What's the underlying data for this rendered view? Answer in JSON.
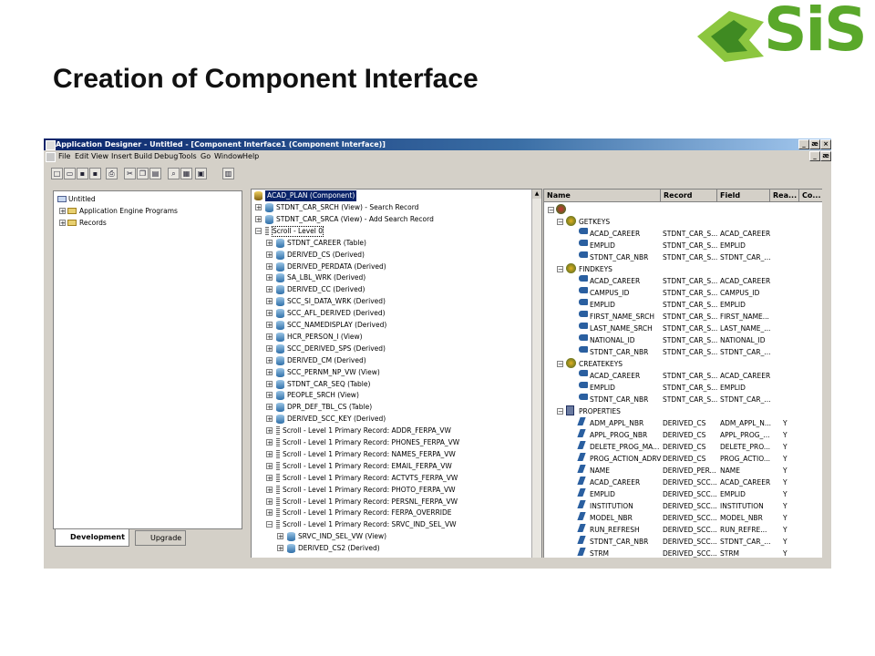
{
  "slide": {
    "title": "Creation of Component Interface",
    "logo_text": "SiS",
    "logo_color": "#5aa82a"
  },
  "window": {
    "title": "Application Designer - Untitled - [Component Interface1 (Component Interface)]",
    "menu": [
      "File",
      "Edit",
      "View",
      "Insert",
      "Build",
      "Debug",
      "Tools",
      "Go",
      "Window",
      "Help"
    ],
    "controls": [
      "_",
      "æ",
      "×"
    ]
  },
  "project": {
    "items": [
      {
        "label": "Untitled",
        "level": 0
      },
      {
        "label": "Application Engine Programs",
        "level": 1
      },
      {
        "label": "Records",
        "level": 1
      }
    ],
    "tabs": [
      "Development",
      "Upgrade"
    ]
  },
  "component_tree": {
    "root": "ACAD_PLAN (Component)",
    "rows": [
      {
        "label": "STDNT_CAR_SRCH (View) - Search Record",
        "indent": 0,
        "icon": "record"
      },
      {
        "label": "STDNT_CAR_SRCA (View) - Add Search Record",
        "indent": 0,
        "icon": "record"
      },
      {
        "label": "Scroll - Level 0",
        "indent": 0,
        "icon": "scroll"
      },
      {
        "label": "STDNT_CAREER (Table)",
        "indent": 1,
        "icon": "record"
      },
      {
        "label": "DERIVED_CS (Derived)",
        "indent": 1,
        "icon": "record"
      },
      {
        "label": "DERIVED_PERDATA (Derived)",
        "indent": 1,
        "icon": "record"
      },
      {
        "label": "SA_LBL_WRK (Derived)",
        "indent": 1,
        "icon": "record"
      },
      {
        "label": "DERIVED_CC (Derived)",
        "indent": 1,
        "icon": "record"
      },
      {
        "label": "SCC_SI_DATA_WRK (Derived)",
        "indent": 1,
        "icon": "record"
      },
      {
        "label": "SCC_AFL_DERIVED (Derived)",
        "indent": 1,
        "icon": "record"
      },
      {
        "label": "SCC_NAMEDISPLAY (Derived)",
        "indent": 1,
        "icon": "record"
      },
      {
        "label": "HCR_PERSON_I (View)",
        "indent": 1,
        "icon": "record"
      },
      {
        "label": "SCC_DERIVED_SPS (Derived)",
        "indent": 1,
        "icon": "record"
      },
      {
        "label": "DERIVED_CM (Derived)",
        "indent": 1,
        "icon": "record"
      },
      {
        "label": "SCC_PERNM_NP_VW (View)",
        "indent": 1,
        "icon": "record"
      },
      {
        "label": "STDNT_CAR_SEQ (Table)",
        "indent": 1,
        "icon": "record"
      },
      {
        "label": "PEOPLE_SRCH (View)",
        "indent": 1,
        "icon": "record"
      },
      {
        "label": "DPR_DEF_TBL_CS (Table)",
        "indent": 1,
        "icon": "record"
      },
      {
        "label": "DERIVED_SCC_KEY (Derived)",
        "indent": 1,
        "icon": "record"
      },
      {
        "label": "Scroll - Level 1  Primary Record: ADDR_FERPA_VW",
        "indent": 1,
        "icon": "scroll"
      },
      {
        "label": "Scroll - Level 1  Primary Record: PHONES_FERPA_VW",
        "indent": 1,
        "icon": "scroll"
      },
      {
        "label": "Scroll - Level 1  Primary Record: NAMES_FERPA_VW",
        "indent": 1,
        "icon": "scroll"
      },
      {
        "label": "Scroll - Level 1  Primary Record: EMAIL_FERPA_VW",
        "indent": 1,
        "icon": "scroll"
      },
      {
        "label": "Scroll - Level 1  Primary Record: ACTVTS_FERPA_VW",
        "indent": 1,
        "icon": "scroll"
      },
      {
        "label": "Scroll - Level 1  Primary Record: PHOTO_FERPA_VW",
        "indent": 1,
        "icon": "scroll"
      },
      {
        "label": "Scroll - Level 1  Primary Record: PERSNL_FERPA_VW",
        "indent": 1,
        "icon": "scroll"
      },
      {
        "label": "Scroll - Level 1  Primary Record: FERPA_OVERRIDE",
        "indent": 1,
        "icon": "scroll"
      },
      {
        "label": "Scroll - Level 1  Primary Record: SRVC_IND_SEL_VW",
        "indent": 1,
        "icon": "scroll"
      },
      {
        "label": "SRVC_IND_SEL_VW (View)",
        "indent": 2,
        "icon": "record"
      },
      {
        "label": "DERIVED_CS2 (Derived)",
        "indent": 2,
        "icon": "record"
      }
    ]
  },
  "ci_grid": {
    "columns": [
      "Name",
      "Record",
      "Field",
      "Rea...",
      "Co..."
    ],
    "rows": [
      {
        "type": "group",
        "name": "GETKEYS",
        "icon": "globe"
      },
      {
        "type": "key",
        "name": "ACAD_CAREER",
        "record": "STDNT_CAR_S...",
        "field": "ACAD_CAREER",
        "read": ""
      },
      {
        "type": "key",
        "name": "EMPLID",
        "record": "STDNT_CAR_S...",
        "field": "EMPLID",
        "read": ""
      },
      {
        "type": "key",
        "name": "STDNT_CAR_NBR",
        "record": "STDNT_CAR_S...",
        "field": "STDNT_CAR_...",
        "read": ""
      },
      {
        "type": "group",
        "name": "FINDKEYS",
        "icon": "globe"
      },
      {
        "type": "key",
        "name": "ACAD_CAREER",
        "record": "STDNT_CAR_S...",
        "field": "ACAD_CAREER",
        "read": ""
      },
      {
        "type": "key",
        "name": "CAMPUS_ID",
        "record": "STDNT_CAR_S...",
        "field": "CAMPUS_ID",
        "read": ""
      },
      {
        "type": "key",
        "name": "EMPLID",
        "record": "STDNT_CAR_S...",
        "field": "EMPLID",
        "read": ""
      },
      {
        "type": "key",
        "name": "FIRST_NAME_SRCH",
        "record": "STDNT_CAR_S...",
        "field": "FIRST_NAME...",
        "read": ""
      },
      {
        "type": "key",
        "name": "LAST_NAME_SRCH",
        "record": "STDNT_CAR_S...",
        "field": "LAST_NAME_...",
        "read": ""
      },
      {
        "type": "key",
        "name": "NATIONAL_ID",
        "record": "STDNT_CAR_S...",
        "field": "NATIONAL_ID",
        "read": ""
      },
      {
        "type": "key",
        "name": "STDNT_CAR_NBR",
        "record": "STDNT_CAR_S...",
        "field": "STDNT_CAR_...",
        "read": ""
      },
      {
        "type": "group",
        "name": "CREATEKEYS",
        "icon": "globe"
      },
      {
        "type": "key",
        "name": "ACAD_CAREER",
        "record": "STDNT_CAR_S...",
        "field": "ACAD_CAREER",
        "read": ""
      },
      {
        "type": "key",
        "name": "EMPLID",
        "record": "STDNT_CAR_S...",
        "field": "EMPLID",
        "read": ""
      },
      {
        "type": "key",
        "name": "STDNT_CAR_NBR",
        "record": "STDNT_CAR_S...",
        "field": "STDNT_CAR_...",
        "read": ""
      },
      {
        "type": "group",
        "name": "PROPERTIES",
        "icon": "props"
      },
      {
        "type": "prop",
        "name": "ADM_APPL_NBR",
        "record": "DERIVED_CS",
        "field": "ADM_APPL_N...",
        "read": "Y"
      },
      {
        "type": "prop",
        "name": "APPL_PROG_NBR",
        "record": "DERIVED_CS",
        "field": "APPL_PROG_...",
        "read": "Y"
      },
      {
        "type": "prop",
        "name": "DELETE_PROG_MA...",
        "record": "DERIVED_CS",
        "field": "DELETE_PRO...",
        "read": "Y"
      },
      {
        "type": "prop",
        "name": "PROG_ACTION_ADRV",
        "record": "DERIVED_CS",
        "field": "PROG_ACTIO...",
        "read": "Y"
      },
      {
        "type": "prop",
        "name": "NAME",
        "record": "DERIVED_PER...",
        "field": "NAME",
        "read": "Y"
      },
      {
        "type": "prop",
        "name": "ACAD_CAREER",
        "record": "DERIVED_SCC...",
        "field": "ACAD_CAREER",
        "read": "Y"
      },
      {
        "type": "prop",
        "name": "EMPLID",
        "record": "DERIVED_SCC...",
        "field": "EMPLID",
        "read": "Y"
      },
      {
        "type": "prop",
        "name": "INSTITUTION",
        "record": "DERIVED_SCC...",
        "field": "INSTITUTION",
        "read": "Y"
      },
      {
        "type": "prop",
        "name": "MODEL_NBR",
        "record": "DERIVED_SCC...",
        "field": "MODEL_NBR",
        "read": "Y"
      },
      {
        "type": "prop",
        "name": "RUN_REFRESH",
        "record": "DERIVED_SCC...",
        "field": "RUN_REFRE...",
        "read": "Y"
      },
      {
        "type": "prop",
        "name": "STDNT_CAR_NBR",
        "record": "DERIVED_SCC...",
        "field": "STDNT_CAR_...",
        "read": "Y"
      },
      {
        "type": "prop",
        "name": "STRM",
        "record": "DERIVED_SCC...",
        "field": "STRM",
        "read": "Y"
      }
    ]
  }
}
